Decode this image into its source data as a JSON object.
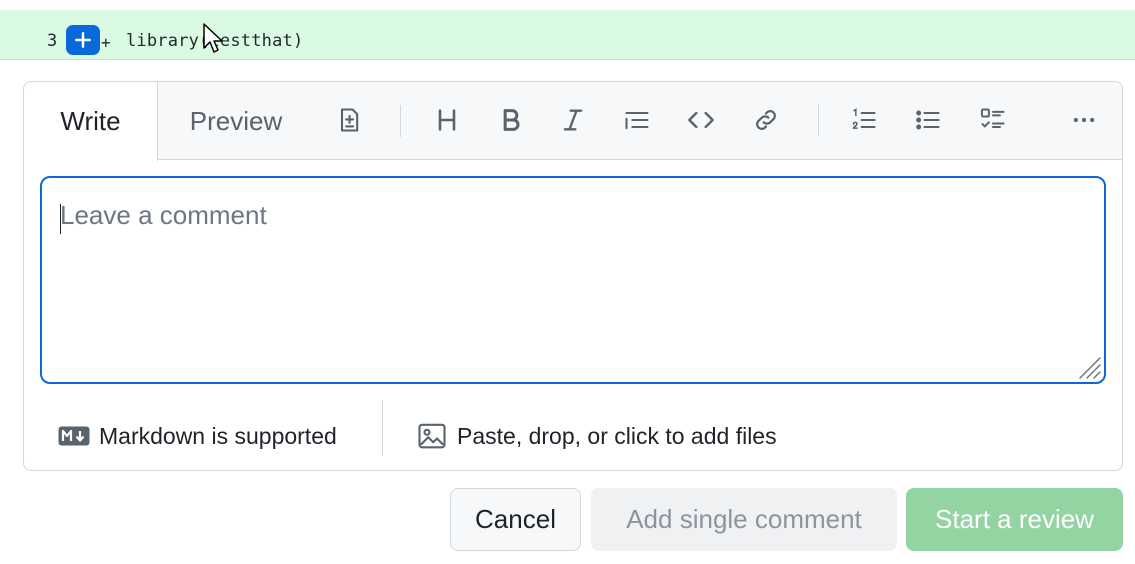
{
  "diff": {
    "line_number": "3",
    "add_button_symbol": "+",
    "marker": "+",
    "code": "library(testthat)"
  },
  "tabs": [
    {
      "label": "Write",
      "selected": true
    },
    {
      "label": "Preview",
      "selected": false
    }
  ],
  "toolbar": {
    "tools": [
      "add-suggestion-icon",
      "heading-icon",
      "bold-icon",
      "italic-icon",
      "quote-icon",
      "code-icon",
      "link-icon",
      "numbered-list-icon",
      "unordered-list-icon",
      "task-list-icon",
      "more-options-icon"
    ]
  },
  "comment": {
    "value": "",
    "placeholder": "Leave a comment"
  },
  "footer": {
    "markdown_label": "Markdown is supported",
    "files_label": "Paste, drop, or click to add files"
  },
  "buttons": {
    "cancel": "Cancel",
    "add_single": "Add single comment",
    "start_review": "Start a review"
  },
  "colors": {
    "accent": "#0969da",
    "diff_add_bg": "#dafbe1",
    "review_button_disabled": "#94d3a2"
  }
}
